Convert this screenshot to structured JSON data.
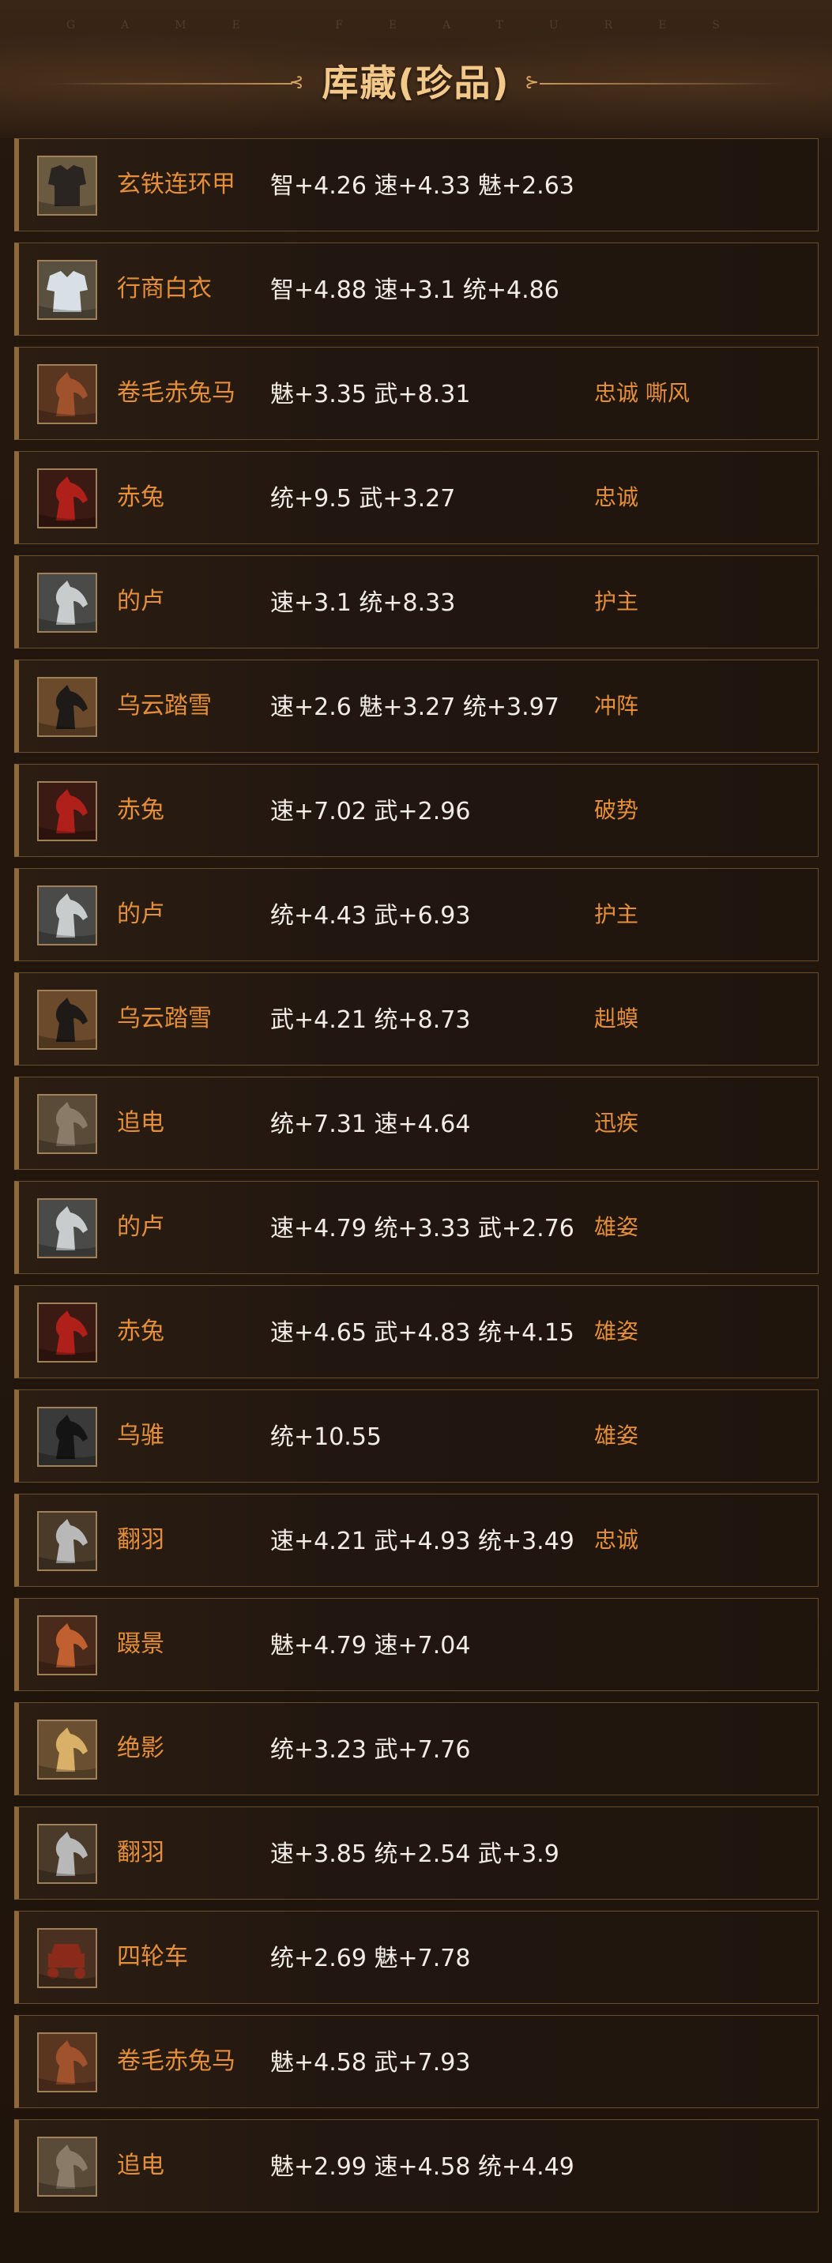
{
  "header": {
    "watermark": "GAME FEATURES",
    "title": "库藏(珍品)",
    "ornament_left": "⊰",
    "ornament_right": "⊱"
  },
  "colors": {
    "accent_name": "#e58f3b",
    "title": "#f3c98a",
    "stats_text": "#f2ede4",
    "row_border": "#6b4e2e"
  },
  "items": [
    {
      "name": "玄铁连环甲",
      "stats": "智+4.26 速+4.33 魅+2.63",
      "traits": "",
      "icon": "armor-icon",
      "bg": "#6a5a40",
      "fg": "#2a2520"
    },
    {
      "name": "行商白衣",
      "stats": "智+4.88 速+3.1 统+4.86",
      "traits": "",
      "icon": "robe-icon",
      "bg": "#5a5040",
      "fg": "#d8e0e6"
    },
    {
      "name": "卷毛赤兔马",
      "stats": "魅+3.35 武+8.31",
      "traits": "忠诚 嘶风",
      "icon": "horse-icon",
      "bg": "#5a3520",
      "fg": "#a0522d"
    },
    {
      "name": "赤兔",
      "stats": "统+9.5 武+3.27",
      "traits": "忠诚",
      "icon": "horse-icon",
      "bg": "#3a1a12",
      "fg": "#b0201a"
    },
    {
      "name": "的卢",
      "stats": "速+3.1 统+8.33",
      "traits": "护主",
      "icon": "horse-icon",
      "bg": "#4a4a48",
      "fg": "#c8cccc"
    },
    {
      "name": "乌云踏雪",
      "stats": "速+2.6 魅+3.27 统+3.97",
      "traits": "冲阵",
      "icon": "horse-icon",
      "bg": "#6a4a2a",
      "fg": "#1e1a18"
    },
    {
      "name": "赤兔",
      "stats": "速+7.02 武+2.96",
      "traits": "破势",
      "icon": "horse-icon",
      "bg": "#3a1a12",
      "fg": "#b0201a"
    },
    {
      "name": "的卢",
      "stats": "统+4.43 武+6.93",
      "traits": "护主",
      "icon": "horse-icon",
      "bg": "#4a4a48",
      "fg": "#c8cccc"
    },
    {
      "name": "乌云踏雪",
      "stats": "武+4.21 统+8.73",
      "traits": "赳蟆",
      "icon": "horse-icon",
      "bg": "#6a4a2a",
      "fg": "#1e1a18"
    },
    {
      "name": "追电",
      "stats": "统+7.31 速+4.64",
      "traits": "迅疾",
      "icon": "horse-icon",
      "bg": "#5a4a38",
      "fg": "#8a7a68"
    },
    {
      "name": "的卢",
      "stats": "速+4.79 统+3.33 武+2.76",
      "traits": "雄姿",
      "icon": "horse-icon",
      "bg": "#4a4a48",
      "fg": "#c8cccc"
    },
    {
      "name": "赤兔",
      "stats": "速+4.65 武+4.83 统+4.15",
      "traits": "雄姿",
      "icon": "horse-icon",
      "bg": "#3a1a12",
      "fg": "#b0201a"
    },
    {
      "name": "乌骓",
      "stats": "统+10.55",
      "traits": "雄姿",
      "icon": "horse-icon",
      "bg": "#3a3a3a",
      "fg": "#141414"
    },
    {
      "name": "翻羽",
      "stats": "速+4.21 武+4.93 统+3.49",
      "traits": "忠诚",
      "icon": "horse-icon",
      "bg": "#4a3a2a",
      "fg": "#b8b8b8"
    },
    {
      "name": "蹑景",
      "stats": "魅+4.79 速+7.04",
      "traits": "",
      "icon": "horse-icon",
      "bg": "#4a2a1a",
      "fg": "#c06030"
    },
    {
      "name": "绝影",
      "stats": "统+3.23 武+7.76",
      "traits": "",
      "icon": "horse-icon",
      "bg": "#6a5030",
      "fg": "#d8b068"
    },
    {
      "name": "翻羽",
      "stats": "速+3.85 统+2.54 武+3.9",
      "traits": "",
      "icon": "horse-icon",
      "bg": "#4a3a2a",
      "fg": "#b8b8b8"
    },
    {
      "name": "四轮车",
      "stats": "统+2.69 魅+7.78",
      "traits": "",
      "icon": "cart-icon",
      "bg": "#4a3020",
      "fg": "#8a2a1a"
    },
    {
      "name": "卷毛赤兔马",
      "stats": "魅+4.58 武+7.93",
      "traits": "",
      "icon": "horse-icon",
      "bg": "#5a3520",
      "fg": "#a0522d"
    },
    {
      "name": "追电",
      "stats": "魅+2.99 速+4.58 统+4.49",
      "traits": "",
      "icon": "horse-icon",
      "bg": "#5a4a38",
      "fg": "#8a7a68"
    }
  ]
}
